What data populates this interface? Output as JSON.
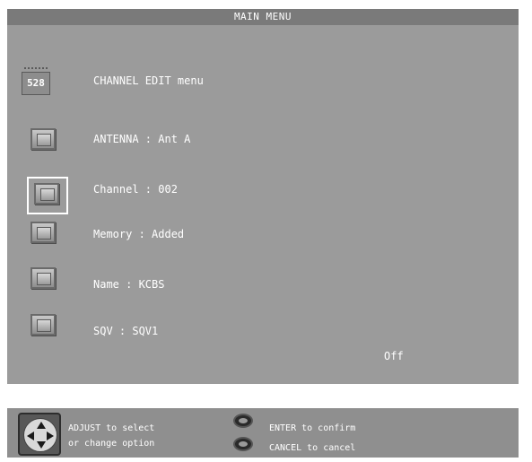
{
  "header": {
    "title": "MAIN MENU"
  },
  "channel_edit": {
    "icon_text": "528",
    "label": "CHANNEL EDIT menu"
  },
  "items": [
    {
      "label": "ANTENNA : Ant A"
    },
    {
      "label": "Channel : 002"
    },
    {
      "label": "Memory : Added"
    },
    {
      "label": "Name : KCBS"
    },
    {
      "label": "SQV : SQV1"
    }
  ],
  "status": {
    "off": "Off"
  },
  "footer": {
    "adjust_line1": "ADJUST to select",
    "adjust_line2": "or change option",
    "enter": "ENTER to confirm",
    "cancel": "CANCEL to cancel"
  }
}
